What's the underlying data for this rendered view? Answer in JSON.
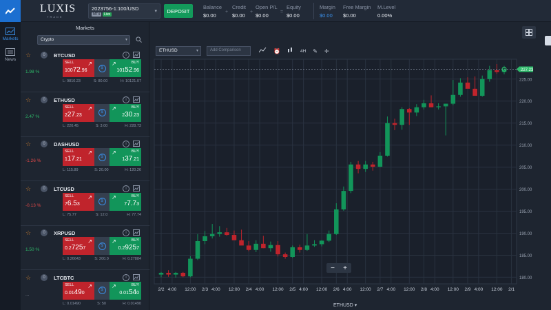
{
  "app": {
    "logo": "LUXIS",
    "logo_sub": "TRADE"
  },
  "account": {
    "number": "2023756-1:100/USD",
    "platform_tag": "MT4",
    "status_tag": "Live"
  },
  "deposit_label": "DEPOSIT",
  "stats": [
    {
      "label": "Balance",
      "value": "$0.00"
    },
    {
      "label": "Credit",
      "value": "$0.00"
    },
    {
      "label": "Open P/L",
      "value": "$0.00"
    },
    {
      "label": "Equity",
      "value": "$0.00"
    },
    {
      "label": "Margin",
      "value": "$0.00"
    },
    {
      "label": "Free Margin",
      "value": "$0.00"
    },
    {
      "label": "M.Level",
      "value": "0.00%"
    }
  ],
  "stat_separators": {
    "plus": "+",
    "equals": "="
  },
  "nav": {
    "markets": "Markets",
    "news": "News"
  },
  "markets": {
    "title": "Markets",
    "filter": "Crypto",
    "rows": [
      {
        "symbol": "BTCUSD",
        "change": "1.98 %",
        "sell_label": "SELL",
        "sell_big": "100",
        "sell_mid": "72",
        "sell_small": ".96",
        "buy_label": "BUY",
        "buy_big": "101",
        "buy_mid": "52",
        "buy_small": ".96",
        "low": "L: 9810.23",
        "spread": "S: 80.00",
        "high": "H: 10121.07"
      },
      {
        "symbol": "ETHUSD",
        "change": "2.47 %",
        "sell_label": "SELL",
        "sell_big": "2",
        "sell_mid": "27",
        "sell_small": ".23",
        "buy_label": "BUY",
        "buy_big": "2",
        "buy_mid": "30",
        "buy_small": ".23",
        "low": "L: 220.45",
        "spread": "S: 3.00",
        "high": "H: 228.73"
      },
      {
        "symbol": "DASHUSD",
        "change": "-1.26 %",
        "sell_label": "SELL",
        "sell_big": "1",
        "sell_mid": "17",
        "sell_small": ".21",
        "buy_label": "BUY",
        "buy_big": "1",
        "buy_mid": "37",
        "buy_small": ".21",
        "low": "L: 115.89",
        "spread": "S: 20.00",
        "high": "H: 120.26"
      },
      {
        "symbol": "LTCUSD",
        "change": "-0.13 %",
        "sell_label": "SELL",
        "sell_big": "7",
        "sell_mid": "6.5",
        "sell_small": "3",
        "buy_label": "BUY",
        "buy_big": "7",
        "buy_mid": "7.7",
        "buy_small": "3",
        "low": "L: 75.77",
        "spread": "S: 12.0",
        "high": "H: 77.74"
      },
      {
        "symbol": "XRPUSD",
        "change": "1.50 %",
        "sell_label": "SELL",
        "sell_big": "0.2",
        "sell_mid": "725",
        "sell_small": "7",
        "buy_label": "BUY",
        "buy_big": "0.2",
        "buy_mid": "925",
        "buy_small": "7",
        "low": "L: 0.26643",
        "spread": "S: 200.0",
        "high": "H: 0.27884"
      },
      {
        "symbol": "LTCBTC",
        "change": "...",
        "sell_label": "SELL",
        "sell_big": "0.01",
        "sell_mid": "49",
        "sell_small": "0",
        "buy_label": "BUY",
        "buy_big": "0.01",
        "buy_mid": "54",
        "buy_small": "0",
        "low": "L: 0.01490",
        "spread": "S: 50",
        "high": "H: 0.01490"
      }
    ]
  },
  "chart_toolbar": {
    "symbol": "ETHUSD",
    "compare_placeholder": "Add Comparison",
    "interval": "4H"
  },
  "chart_footer": "ETHUSD",
  "colors": {
    "up": "#12955a",
    "down": "#c0242c",
    "accent": "#3a8ee6"
  },
  "chart_data": {
    "type": "candlestick",
    "symbol": "ETHUSD",
    "last_price_label": "227.23",
    "y_ticks": [
      180,
      185,
      190,
      195,
      200,
      205,
      210,
      215,
      220,
      225
    ],
    "y_tick_labels": [
      "180.00",
      "185.00",
      "190.00",
      "195.00",
      "200.00",
      "205.00",
      "210.00",
      "215.00",
      "220.00",
      "225.00"
    ],
    "ylim": [
      178.5,
      229.5
    ],
    "x_ticks": [
      {
        "label": "2/2",
        "i": 0
      },
      {
        "label": "4:00",
        "i": 1.5
      },
      {
        "label": "12:00",
        "i": 4
      },
      {
        "label": "2/3",
        "i": 6
      },
      {
        "label": "4:00",
        "i": 7.5
      },
      {
        "label": "12:00",
        "i": 10
      },
      {
        "label": "2/4",
        "i": 12
      },
      {
        "label": "4:00",
        "i": 13.5
      },
      {
        "label": "12:00",
        "i": 16
      },
      {
        "label": "2/5",
        "i": 18
      },
      {
        "label": "4:00",
        "i": 19.5
      },
      {
        "label": "12:00",
        "i": 22
      },
      {
        "label": "2/6",
        "i": 24
      },
      {
        "label": "4:00",
        "i": 25.5
      },
      {
        "label": "12:00",
        "i": 28
      },
      {
        "label": "2/7",
        "i": 30
      },
      {
        "label": "4:00",
        "i": 31.5
      },
      {
        "label": "12:00",
        "i": 34
      },
      {
        "label": "2/8",
        "i": 36
      },
      {
        "label": "4:00",
        "i": 37.5
      },
      {
        "label": "12:00",
        "i": 40
      },
      {
        "label": "2/9",
        "i": 42
      },
      {
        "label": "4:00",
        "i": 43.5
      },
      {
        "label": "12:00",
        "i": 46
      },
      {
        "label": "2/1",
        "i": 48
      }
    ],
    "candles": [
      {
        "o": 180.6,
        "h": 181.2,
        "l": 180.0,
        "c": 181.0
      },
      {
        "o": 181.0,
        "h": 181.6,
        "l": 180.1,
        "c": 180.6
      },
      {
        "o": 180.6,
        "h": 181.2,
        "l": 179.9,
        "c": 181.0
      },
      {
        "o": 181.0,
        "h": 181.2,
        "l": 180.0,
        "c": 180.2
      },
      {
        "o": 180.2,
        "h": 184.8,
        "l": 180.0,
        "c": 184.2
      },
      {
        "o": 184.2,
        "h": 189.8,
        "l": 183.9,
        "c": 188.2
      },
      {
        "o": 188.2,
        "h": 190.5,
        "l": 187.5,
        "c": 189.3
      },
      {
        "o": 189.3,
        "h": 192.1,
        "l": 188.8,
        "c": 189.8
      },
      {
        "o": 189.8,
        "h": 191.6,
        "l": 189.2,
        "c": 190.2
      },
      {
        "o": 190.2,
        "h": 191.2,
        "l": 189.4,
        "c": 189.6
      },
      {
        "o": 189.6,
        "h": 190.6,
        "l": 188.7,
        "c": 188.4
      },
      {
        "o": 188.4,
        "h": 190.8,
        "l": 187.5,
        "c": 187.2
      },
      {
        "o": 187.2,
        "h": 188.2,
        "l": 185.9,
        "c": 186.2
      },
      {
        "o": 186.2,
        "h": 188.4,
        "l": 185.7,
        "c": 187.6
      },
      {
        "o": 187.6,
        "h": 189.4,
        "l": 186.6,
        "c": 186.6
      },
      {
        "o": 186.6,
        "h": 188.1,
        "l": 185.8,
        "c": 187.3
      },
      {
        "o": 187.3,
        "h": 188.2,
        "l": 184.7,
        "c": 185.2
      },
      {
        "o": 185.2,
        "h": 185.6,
        "l": 184.2,
        "c": 184.6
      },
      {
        "o": 184.6,
        "h": 187.2,
        "l": 184.4,
        "c": 186.8
      },
      {
        "o": 186.8,
        "h": 187.4,
        "l": 185.6,
        "c": 186.2
      },
      {
        "o": 186.2,
        "h": 189.8,
        "l": 186.0,
        "c": 187.2
      },
      {
        "o": 187.2,
        "h": 188.4,
        "l": 186.9,
        "c": 187.5
      },
      {
        "o": 187.5,
        "h": 188.4,
        "l": 187.0,
        "c": 188.3
      },
      {
        "o": 188.3,
        "h": 190.6,
        "l": 188.0,
        "c": 189.8
      },
      {
        "o": 189.8,
        "h": 196.8,
        "l": 189.6,
        "c": 195.4
      },
      {
        "o": 195.4,
        "h": 200.6,
        "l": 195.1,
        "c": 199.6
      },
      {
        "o": 199.6,
        "h": 206.2,
        "l": 199.1,
        "c": 205.6
      },
      {
        "o": 205.6,
        "h": 206.4,
        "l": 203.6,
        "c": 204.6
      },
      {
        "o": 204.6,
        "h": 206.4,
        "l": 203.9,
        "c": 205.6
      },
      {
        "o": 205.6,
        "h": 206.2,
        "l": 204.2,
        "c": 205.1
      },
      {
        "o": 205.1,
        "h": 208.4,
        "l": 205.0,
        "c": 207.6
      },
      {
        "o": 207.6,
        "h": 216.5,
        "l": 207.4,
        "c": 215.0
      },
      {
        "o": 215.0,
        "h": 216.0,
        "l": 213.4,
        "c": 214.6
      },
      {
        "o": 214.6,
        "h": 218.6,
        "l": 213.5,
        "c": 218.2
      },
      {
        "o": 218.2,
        "h": 218.4,
        "l": 214.6,
        "c": 217.4
      },
      {
        "o": 217.4,
        "h": 219.3,
        "l": 216.6,
        "c": 218.6
      },
      {
        "o": 218.6,
        "h": 220.3,
        "l": 218.1,
        "c": 219.5
      },
      {
        "o": 219.5,
        "h": 221.3,
        "l": 218.6,
        "c": 218.6
      },
      {
        "o": 218.6,
        "h": 219.5,
        "l": 218.1,
        "c": 218.8
      },
      {
        "o": 218.8,
        "h": 219.4,
        "l": 212.2,
        "c": 219.4
      },
      {
        "o": 219.4,
        "h": 224.8,
        "l": 219.1,
        "c": 221.4
      },
      {
        "o": 221.4,
        "h": 225.2,
        "l": 221.0,
        "c": 224.2
      },
      {
        "o": 224.2,
        "h": 225.4,
        "l": 223.0,
        "c": 222.8
      },
      {
        "o": 222.8,
        "h": 225.6,
        "l": 221.4,
        "c": 221.2
      },
      {
        "o": 221.2,
        "h": 225.8,
        "l": 221.0,
        "c": 225.0
      },
      {
        "o": 225.0,
        "h": 228.0,
        "l": 224.4,
        "c": 227.0
      },
      {
        "o": 227.0,
        "h": 228.4,
        "l": 226.2,
        "c": 226.6
      },
      {
        "o": 226.6,
        "h": 228.0,
        "l": 226.1,
        "c": 227.2
      }
    ]
  }
}
